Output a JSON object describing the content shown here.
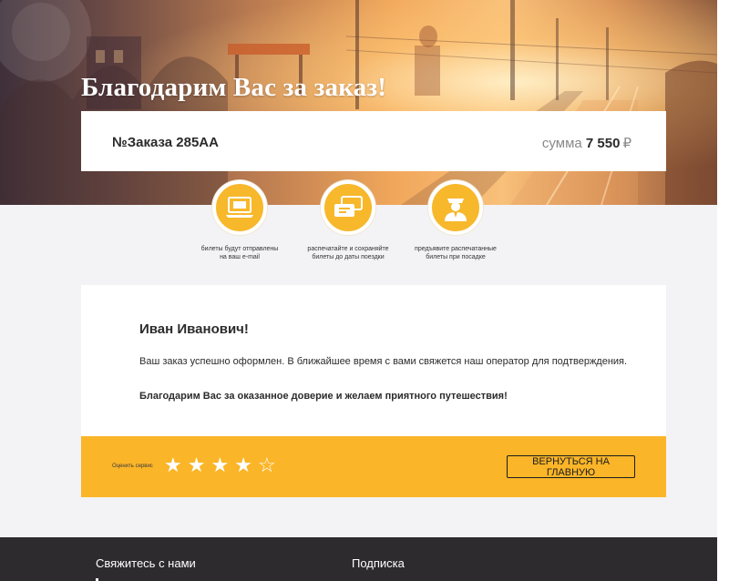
{
  "hero": {
    "title": "Благодарим Вас за заказ!"
  },
  "order": {
    "number": "№Заказа 285АА",
    "sum_label": "сумма",
    "sum_value": "7 550",
    "currency": "₽"
  },
  "steps": [
    {
      "icon": "laptop-ticket-icon",
      "text": "билеты будут отправлены на ваш e-mail"
    },
    {
      "icon": "tickets-icon",
      "text": "распечатайте и сохраняйте билеты до даты поездки"
    },
    {
      "icon": "conductor-icon",
      "text": "предъявите распечатанные билеты при посадке"
    }
  ],
  "message": {
    "greeting": "Иван Иванович!",
    "text": "Ваш заказ успешно оформлен. В ближайшее время с вами свяжется наш оператор для подтверждения.",
    "thanks": "Благодарим Вас за оказанное доверие и желаем приятного путешествия!"
  },
  "rating": {
    "label": "Оценить сервис",
    "value": 4,
    "max": 5,
    "star_filled": "★",
    "star_empty": "☆"
  },
  "actions": {
    "back_label": "ВЕРНУТЬСЯ НА ГЛАВНУЮ"
  },
  "footer": {
    "contact_title": "Свяжитесь с нами",
    "subscribe_title": "Подписка"
  },
  "colors": {
    "accent": "#fbb528",
    "icon_circle": "#f7b82b",
    "footer_bg": "#2d2b2e",
    "page_bg": "#f3f3f5"
  }
}
